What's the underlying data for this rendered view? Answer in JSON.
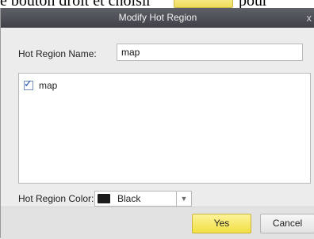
{
  "background": {
    "text_left": "e bouton droit et choisir",
    "text_right": "pour"
  },
  "dialog": {
    "title": "Modify Hot Region",
    "close_glyph": "x",
    "name_label": "Hot Region Name:",
    "name_value": "map",
    "list_items": [
      {
        "label": "map",
        "checked": true
      }
    ],
    "color_label": "Hot Region Color:",
    "color_value": "Black",
    "color_swatch": "#1b1b1b",
    "dropdown_icon": "chevron-down-icon",
    "yes_label": "Yes",
    "cancel_label": "Cancel"
  },
  "colors": {
    "titlebar": "#4a4d53",
    "yes_button": "#f3e04b",
    "dialog_bg": "#ececec"
  }
}
